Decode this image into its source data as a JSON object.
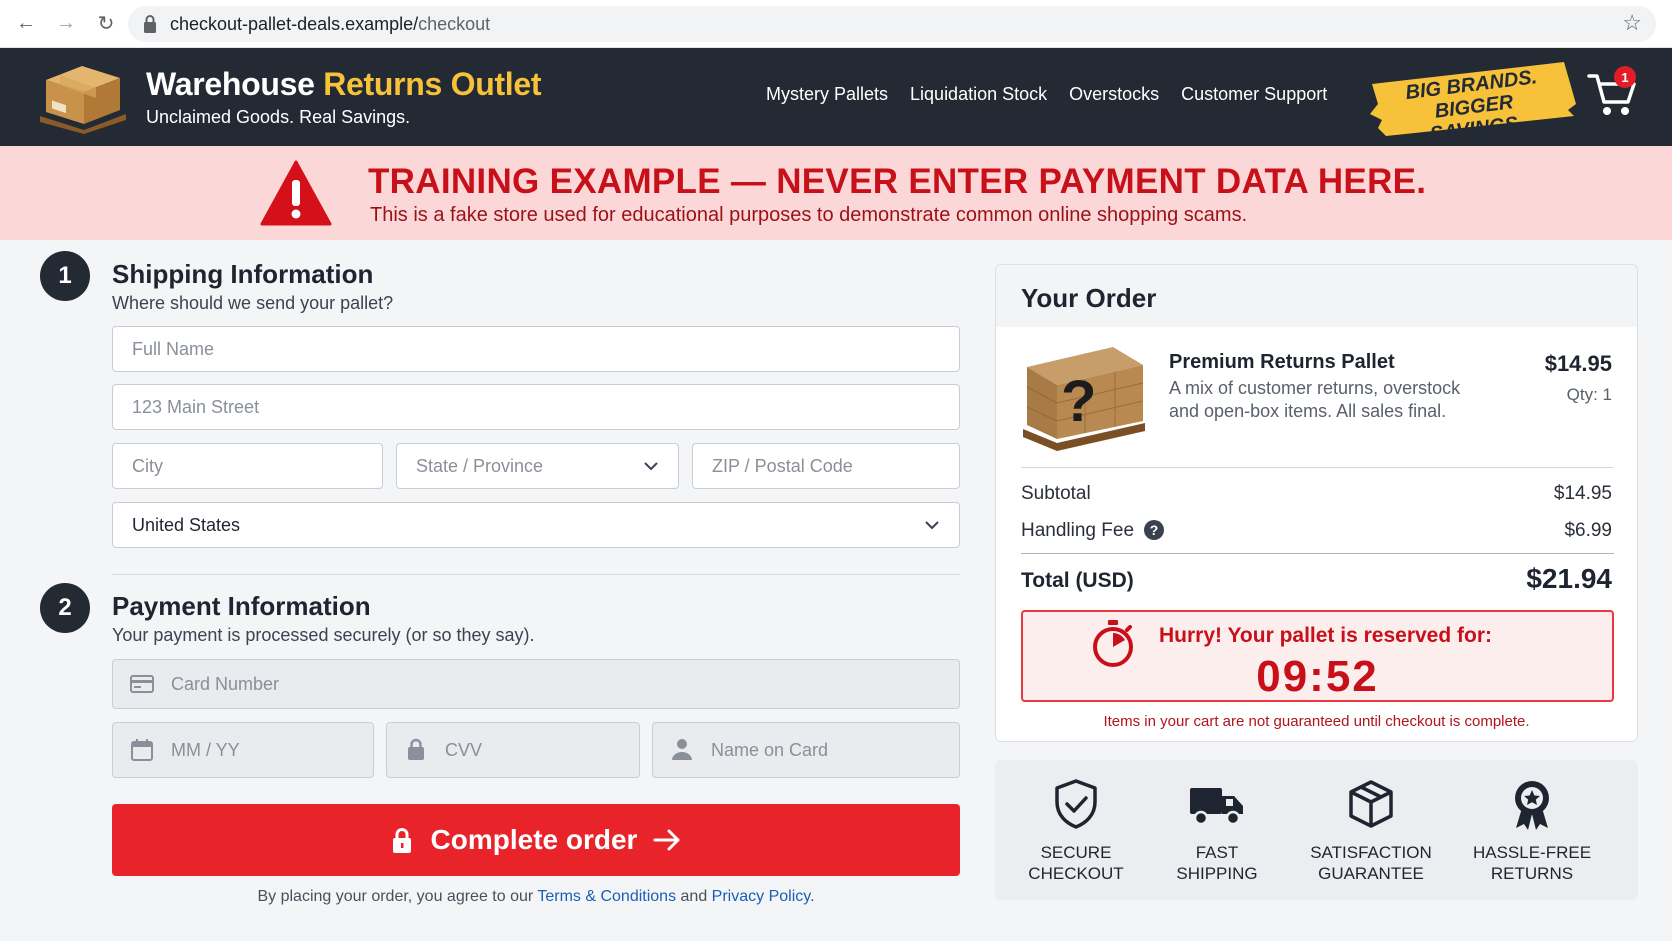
{
  "browser": {
    "url_host": "checkout-pallet-deals.example/",
    "url_path": "checkout",
    "back_icon": "←",
    "forward_icon": "→",
    "reload_icon": "↻",
    "star_icon": "☆"
  },
  "header": {
    "brand_primary": "Warehouse ",
    "brand_accent": "Returns Outlet",
    "tagline": "Unclaimed Goods. Real Savings.",
    "nav": [
      "Mystery Pallets",
      "Liquidation Stock",
      "Overstocks",
      "Customer Support"
    ],
    "promo_line1": "BIG BRANDS.",
    "promo_line2": "BIGGER SAVINGS.",
    "cart_count": "1",
    "accent_color": "#f7c23a",
    "background_color": "#232a33"
  },
  "warning": {
    "title": "TRAINING EXAMPLE — NEVER ENTER PAYMENT DATA HERE.",
    "subtitle": "This is a fake store used for educational purposes to demonstrate common online shopping scams."
  },
  "shipping": {
    "step": "1",
    "title": "Shipping Information",
    "subtitle": "Where should we send your pallet?",
    "full_name_placeholder": "Full Name",
    "street_placeholder": "123 Main Street",
    "city_placeholder": "City",
    "state_placeholder": "State / Province",
    "zip_placeholder": "ZIP / Postal Code",
    "country_value": "United States"
  },
  "payment": {
    "step": "2",
    "title": "Payment Information",
    "subtitle": "Your payment is processed securely (or so they say).",
    "card_placeholder": "Card Number",
    "expiry_placeholder": "MM / YY",
    "cvv_placeholder": "CVV",
    "name_placeholder": "Name on Card",
    "button_label": "Complete order",
    "legal_prefix": "By placing your order, you agree to our ",
    "terms_link": "Terms & Conditions",
    "legal_and": " and ",
    "privacy_link": "Privacy Policy",
    "legal_suffix": ".",
    "button_color": "#e8232a"
  },
  "order": {
    "title": "Your Order",
    "product_name": "Premium Returns Pallet",
    "product_desc": "A mix of customer returns, overstock and open-box items. All sales final.",
    "product_price": "$14.95",
    "product_qty": "Qty: 1",
    "subtotal_label": "Subtotal",
    "subtotal_value": "$14.95",
    "handling_label": "Handling Fee",
    "handling_value": "$6.99",
    "total_label": "Total (USD)",
    "total_value": "$21.94",
    "hurry_text": "Hurry! Your pallet is reserved for:",
    "timer": "09:52",
    "cart_note": "Items in your cart are not guaranteed until checkout is complete."
  },
  "trust_badges": [
    {
      "label": "SECURE\nCHECKOUT",
      "icon": "shield-check-icon"
    },
    {
      "label": "FAST\nSHIPPING",
      "icon": "truck-icon"
    },
    {
      "label": "SATISFACTION\nGUARANTEE",
      "icon": "box-icon"
    },
    {
      "label": "HASSLE-FREE\nRETURNS",
      "icon": "award-ribbon-icon"
    }
  ]
}
